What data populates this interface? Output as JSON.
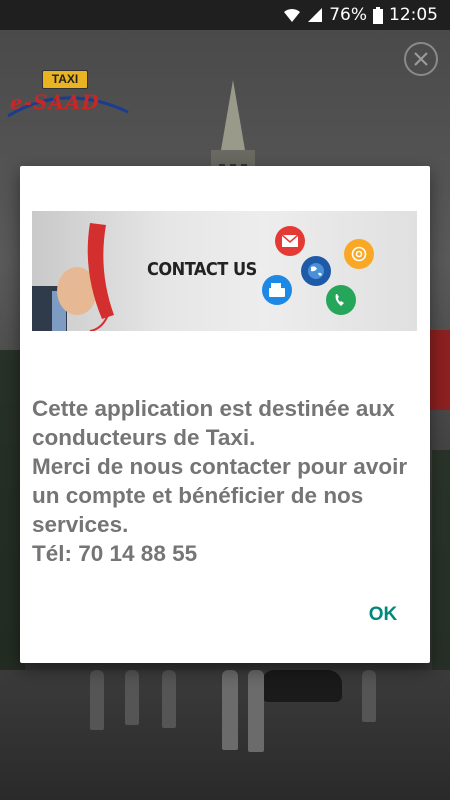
{
  "status_bar": {
    "battery": "76%",
    "time": "12:05",
    "icons": [
      "wifi-icon",
      "signal-icon",
      "battery-icon"
    ]
  },
  "logo": {
    "sign_text": "TAXI",
    "brand_text": "e-SAAD"
  },
  "dialog": {
    "banner_title": "CONTACT US",
    "banner_icons": [
      "mail-icon",
      "globe-icon",
      "at-icon",
      "fax-icon",
      "phone-icon"
    ],
    "message": "Cette application est destinée aux conducteurs de Taxi.\nMerci de nous contacter pour avoir un compte et bénéficier de nos services.\nTél: 70 14 88 55",
    "ok_label": "OK"
  },
  "colors": {
    "accent": "#00897b",
    "message_text": "#757575",
    "brand_red": "#c62828",
    "taxi_yellow": "#e9b322"
  }
}
